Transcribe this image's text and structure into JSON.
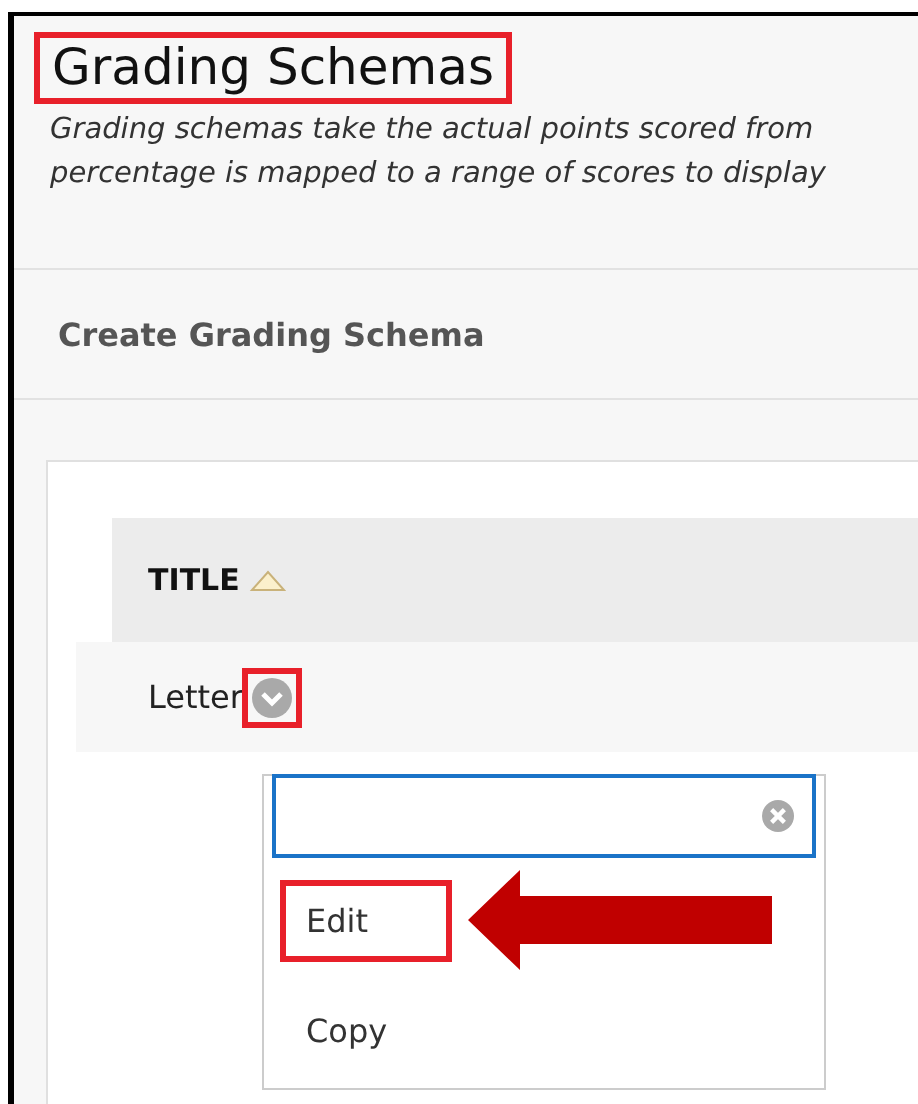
{
  "page": {
    "title": "Grading Schemas",
    "title_highlighted": true,
    "description": "Grading schemas take the actual points scored from\npercentage is mapped to a range of scores to display"
  },
  "action_bar": {
    "items": [
      "Create Grading Schema"
    ]
  },
  "table": {
    "columns": [
      {
        "label": "TITLE",
        "sorted_ascending": true
      }
    ],
    "rows": [
      {
        "title": "Letter",
        "menu_button_highlighted": true
      }
    ]
  },
  "context_menu": {
    "items": [
      {
        "label": "Edit",
        "highlighted": true,
        "pointed_at": true
      },
      {
        "label": "Copy",
        "highlighted": false,
        "pointed_at": false
      }
    ]
  }
}
